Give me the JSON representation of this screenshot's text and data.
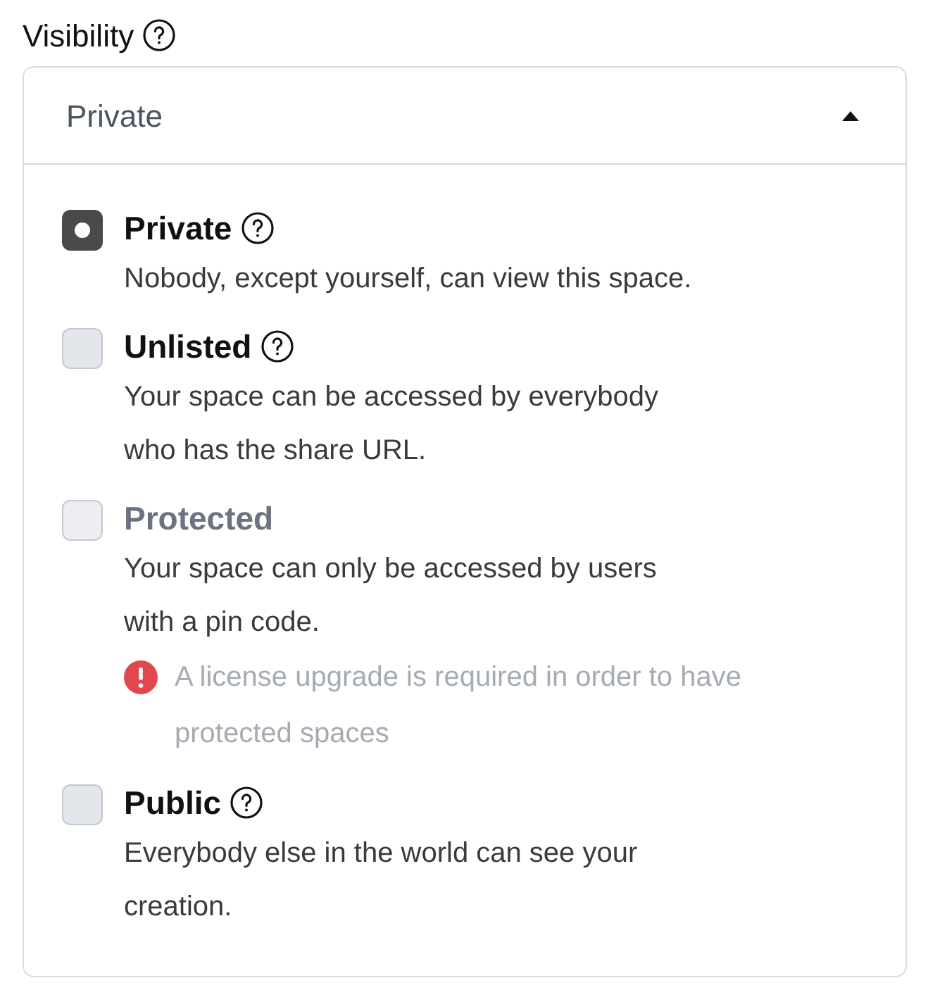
{
  "field": {
    "label": "Visibility",
    "help": true
  },
  "dropdown": {
    "value": "Private",
    "expanded": true
  },
  "options": [
    {
      "title": "Private",
      "help": true,
      "description": "Nobody, except yourself, can view this space.",
      "selected": true,
      "disabled": false
    },
    {
      "title": "Unlisted",
      "help": true,
      "description": "Your space can be accessed by everybody who has the share URL.",
      "selected": false,
      "disabled": false
    },
    {
      "title": "Protected",
      "help": false,
      "description": "Your space can only be accessed by users with a pin code.",
      "selected": false,
      "disabled": true,
      "warning": "A license upgrade is required in order to have protected spaces"
    },
    {
      "title": "Public",
      "help": true,
      "description": "Everybody else in the world can see your creation.",
      "selected": false,
      "disabled": false
    }
  ]
}
